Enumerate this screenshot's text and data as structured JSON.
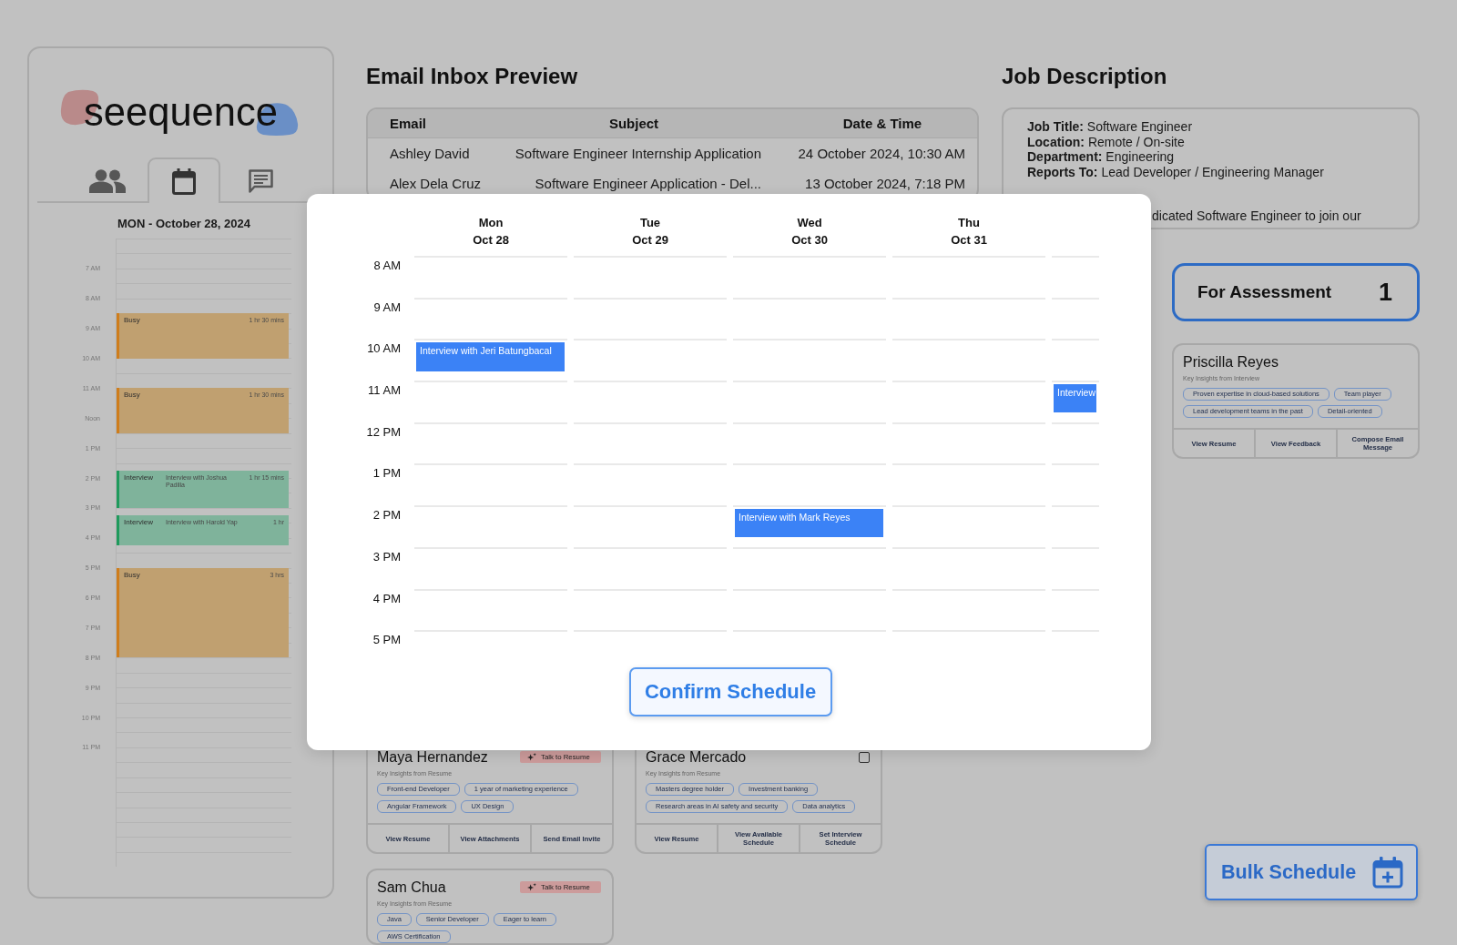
{
  "sidebar": {
    "logo": "seequence",
    "tabs": [
      {
        "kind": "people",
        "selected": false
      },
      {
        "kind": "calendar",
        "selected": true
      },
      {
        "kind": "chat",
        "selected": false
      }
    ],
    "date": "MON - October 28, 2024",
    "time_labels": [
      "7 AM",
      "8 AM",
      "9 AM",
      "10 AM",
      "11 AM",
      "Noon",
      "1 PM",
      "2 PM",
      "3 PM",
      "4 PM",
      "5 PM",
      "6 PM",
      "7 PM",
      "8 PM",
      "9 PM",
      "10 PM",
      "11 PM"
    ],
    "events": [
      {
        "kind": "busy",
        "title": "Busy",
        "duration": "1 hr 30 mins"
      },
      {
        "kind": "busy",
        "title": "Busy",
        "duration": "1 hr 30 mins"
      },
      {
        "kind": "interview",
        "title": "Interview",
        "description": "Interview with Joshua Padilla",
        "duration": "1 hr 15 mins"
      },
      {
        "kind": "interview",
        "title": "Interview",
        "description": "Interview with Harold Yap",
        "duration": "1 hr"
      },
      {
        "kind": "busy",
        "title": "Busy",
        "duration": "3 hrs"
      }
    ]
  },
  "email_inbox": {
    "title": "Email Inbox Preview",
    "columns": [
      "Email",
      "Subject",
      "Date & Time"
    ],
    "rows": [
      {
        "email": "Ashley David",
        "subject": "Software Engineer Internship Application",
        "date_time": "24 October 2024, 10:30 AM"
      },
      {
        "email": "Alex Dela Cruz",
        "subject": "Software Engineer Application - Del...",
        "date_time": "13 October 2024, 7:18 PM"
      }
    ]
  },
  "job_description": {
    "title": "Job Description",
    "lines": [
      "**Job Title:** Software Engineer",
      "**Location:** Remote / On-site",
      "**Department:** Engineering",
      "**Reports To:** Lead Developer / Engineering Manager"
    ],
    "summary": "dicated Software Engineer to join our"
  },
  "board": {
    "columns": [
      {
        "cards": [
          {
            "name": "Maya Hernandez",
            "badge": "Talk to Resume",
            "insights_label": "Key Insights from Resume",
            "insights": [
              "Front-end Developer",
              "1 year of marketing experience",
              "Angular Framework",
              "UX Design"
            ],
            "actions": [
              "View Resume",
              "View Attachments",
              "Send Email Invite"
            ]
          },
          {
            "name": "Sam Chua",
            "badge": "Talk to Resume",
            "insights_label": "Key Insights from Resume",
            "insights": [
              "Java",
              "Senior Developer",
              "Eager to learn",
              "AWS Certification"
            ]
          }
        ]
      },
      {
        "cards": [
          {
            "name": "Grace Mercado",
            "checkbox": {
              "checked": false
            },
            "insights_label": "Key Insights from Resume",
            "insights": [
              "Masters degree holder",
              "Investment banking",
              "Research areas in AI safety and security",
              "Data analytics"
            ],
            "actions": [
              "View Resume",
              "View Available Schedule",
              "Set Interview Schedule"
            ]
          }
        ]
      },
      {
        "header": {
          "title": "For Assessment",
          "count": "1"
        },
        "cards": [
          {
            "name": "Priscilla Reyes",
            "insights_label": "Key Insights from Interview",
            "insights": [
              "Proven expertise in cloud-based solutions",
              "Team player",
              "Lead development teams in the past",
              "Detail-oriented"
            ],
            "actions": [
              "View Resume",
              "View Feedback",
              "Compose Email Message"
            ]
          }
        ]
      }
    ]
  },
  "schedule_modal": {
    "days": [
      {
        "day": "Mon",
        "date": "Oct 28",
        "events": [
          {
            "title": "Interview with Jeri Batungbacal"
          }
        ]
      },
      {
        "day": "Tue",
        "date": "Oct 29"
      },
      {
        "day": "Wed",
        "date": "Oct 30",
        "events": [
          {
            "title": "Interview with Mark Reyes"
          }
        ]
      },
      {
        "day": "Thu",
        "date": "Oct 31"
      },
      {
        "events": [
          {
            "title": "Interview"
          }
        ]
      }
    ],
    "time_labels": [
      "8 AM",
      "9 AM",
      "10 AM",
      "11 AM",
      "12 PM",
      "1 PM",
      "2 PM",
      "3 PM",
      "4 PM",
      "5 PM"
    ],
    "confirm_button": "Confirm Schedule"
  },
  "bulk_schedule_button": "Bulk Schedule"
}
